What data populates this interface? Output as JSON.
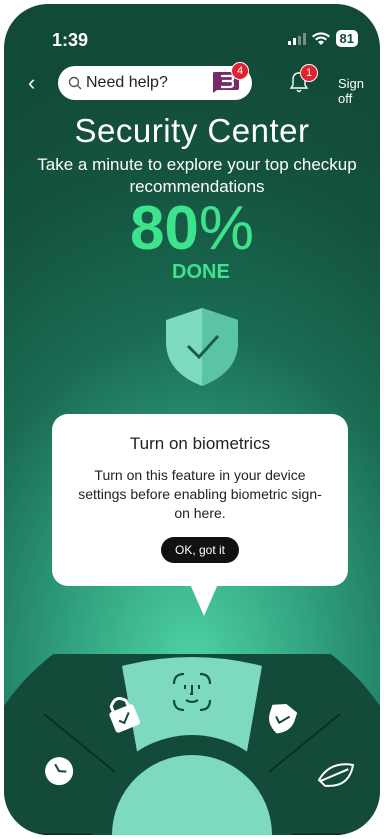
{
  "status": {
    "time": "1:39",
    "battery": "81"
  },
  "topbar": {
    "search_placeholder": "Need help?",
    "chat_badge": "4",
    "bell_badge": "1",
    "sign_off": "Sign off"
  },
  "header": {
    "title": "Security Center",
    "subtitle": "Take a minute to explore your top checkup recommendations"
  },
  "progress": {
    "value": "80",
    "unit": "%",
    "label": "DONE",
    "fraction": 0.8
  },
  "popup": {
    "title": "Turn on biometrics",
    "body": "Turn on this feature in your device settings before enabling biometric sign-on here.",
    "button": "OK, got it"
  },
  "wheel": {
    "items": [
      "lock-icon",
      "face-id-icon",
      "shield-icon",
      "leaf-icon",
      "clock-icon"
    ]
  },
  "colors": {
    "accent": "#3ee38e",
    "background": "#124a39",
    "wheel_active": "#7dd9c0"
  }
}
